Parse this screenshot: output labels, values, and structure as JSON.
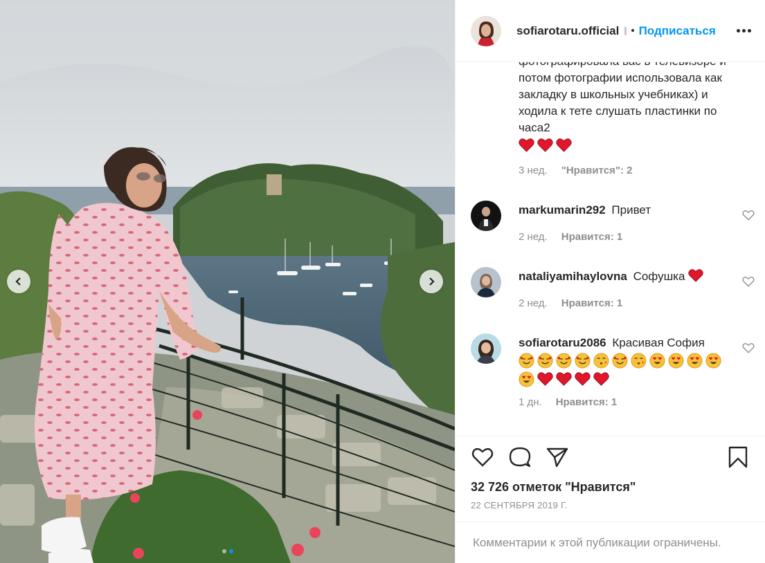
{
  "post": {
    "username": "sofiarotaru.official",
    "separator": "•",
    "follow_label": "Подписаться",
    "more_icon": "more-options-icon",
    "caption": {
      "text": "фотографировала вас в телевизоре и потом фотографии использовала как закладку в школьных учебниках) и ходила к тете слушать пластинки по часа2",
      "emoji_count": 3,
      "time": "3 нед.",
      "likes": "\"Нравится\": 2"
    },
    "comments": [
      {
        "user": "markumarin292",
        "text": "Привет",
        "time": "2 нед.",
        "likes": "Нравится: 1",
        "emoji": ""
      },
      {
        "user": "nataliyamihaylovna",
        "text": "Софушка",
        "time": "2 нед.",
        "likes": "Нравится: 1",
        "emoji": "heart"
      },
      {
        "user": "sofiarotaru2086",
        "text": "Красивая София",
        "time": "1 дн.",
        "likes": "Нравится: 1"
      }
    ],
    "likes_count": "32 726 отметок \"Нравится\"",
    "date": "22 СЕНТЯБРЯ 2019 Г.",
    "comments_limited": "Комментарии к этой публикации ограничены."
  },
  "colors": {
    "link": "#0095f6",
    "muted": "#8e8e8e",
    "text": "#262626",
    "heart": "#e0162b"
  },
  "carousel": {
    "slides": 2,
    "current": 1
  }
}
